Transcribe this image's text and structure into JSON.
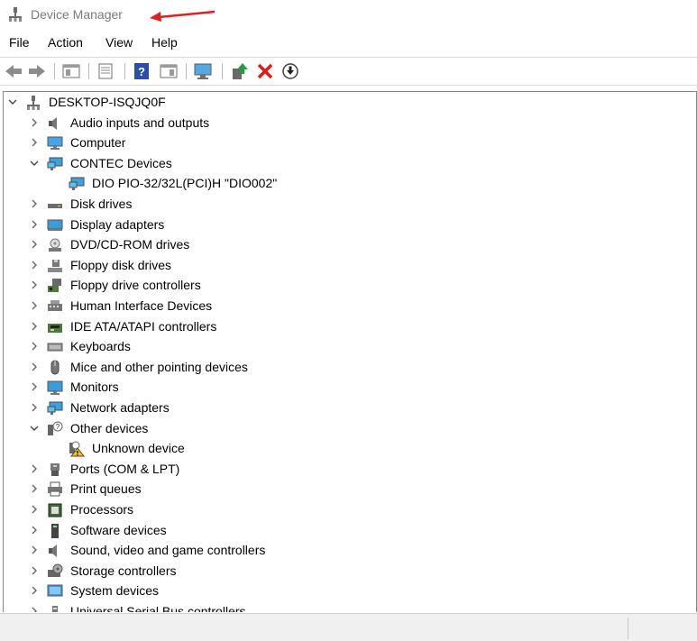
{
  "window": {
    "title": "Device Manager"
  },
  "menu": [
    {
      "label": "File"
    },
    {
      "label": "Action"
    },
    {
      "label": "View"
    },
    {
      "label": "Help"
    }
  ],
  "toolbar": [
    {
      "name": "back-button",
      "icon": "arrow-left-icon"
    },
    {
      "name": "forward-button",
      "icon": "arrow-right-icon"
    },
    {
      "name": "show-hide-console-tree-button",
      "icon": "console-tree-icon"
    },
    {
      "name": "properties-button",
      "icon": "properties-icon"
    },
    {
      "name": "help-button",
      "icon": "help-icon"
    },
    {
      "name": "action-pane-button",
      "icon": "action-pane-icon"
    },
    {
      "name": "scan-hardware-button",
      "icon": "monitor-scan-icon"
    },
    {
      "name": "update-driver-button",
      "icon": "update-driver-icon"
    },
    {
      "name": "uninstall-device-button",
      "icon": "red-x-icon"
    },
    {
      "name": "disable-device-button",
      "icon": "down-arrow-circle-icon"
    }
  ],
  "tree": {
    "root": "DESKTOP-ISQJQ0F",
    "items": [
      {
        "label": "Audio inputs and outputs",
        "icon": "speaker-icon",
        "state": "collapsed",
        "level": 1
      },
      {
        "label": "Computer",
        "icon": "computer-icon",
        "state": "collapsed",
        "level": 1
      },
      {
        "label": "CONTEC Devices",
        "icon": "network-monitor-icon",
        "state": "expanded",
        "level": 1
      },
      {
        "label": "DIO PIO-32/32L(PCI)H \"DIO002\"",
        "icon": "network-monitor-icon",
        "state": "leaf",
        "level": 2
      },
      {
        "label": "Disk drives",
        "icon": "disk-drive-icon",
        "state": "collapsed",
        "level": 1
      },
      {
        "label": "Display adapters",
        "icon": "display-adapter-icon",
        "state": "collapsed",
        "level": 1
      },
      {
        "label": "DVD/CD-ROM drives",
        "icon": "dvd-drive-icon",
        "state": "collapsed",
        "level": 1
      },
      {
        "label": "Floppy disk drives",
        "icon": "floppy-drive-icon",
        "state": "collapsed",
        "level": 1
      },
      {
        "label": "Floppy drive controllers",
        "icon": "floppy-controller-icon",
        "state": "collapsed",
        "level": 1
      },
      {
        "label": "Human Interface Devices",
        "icon": "hid-icon",
        "state": "collapsed",
        "level": 1
      },
      {
        "label": "IDE ATA/ATAPI controllers",
        "icon": "ide-controller-icon",
        "state": "collapsed",
        "level": 1
      },
      {
        "label": "Keyboards",
        "icon": "keyboard-icon",
        "state": "collapsed",
        "level": 1
      },
      {
        "label": "Mice and other pointing devices",
        "icon": "mouse-icon",
        "state": "collapsed",
        "level": 1
      },
      {
        "label": "Monitors",
        "icon": "monitor-icon",
        "state": "collapsed",
        "level": 1
      },
      {
        "label": "Network adapters",
        "icon": "network-adapter-icon",
        "state": "collapsed",
        "level": 1
      },
      {
        "label": "Other devices",
        "icon": "other-devices-icon",
        "state": "expanded",
        "level": 1
      },
      {
        "label": "Unknown device",
        "icon": "unknown-device-warning-icon",
        "state": "leaf",
        "level": 2
      },
      {
        "label": "Ports (COM & LPT)",
        "icon": "port-icon",
        "state": "collapsed",
        "level": 1
      },
      {
        "label": "Print queues",
        "icon": "printer-icon",
        "state": "collapsed",
        "level": 1
      },
      {
        "label": "Processors",
        "icon": "processor-icon",
        "state": "collapsed",
        "level": 1
      },
      {
        "label": "Software devices",
        "icon": "software-device-icon",
        "state": "collapsed",
        "level": 1
      },
      {
        "label": "Sound, video and game controllers",
        "icon": "speaker-icon",
        "state": "collapsed",
        "level": 1
      },
      {
        "label": "Storage controllers",
        "icon": "storage-controller-icon",
        "state": "collapsed",
        "level": 1
      },
      {
        "label": "System devices",
        "icon": "system-device-icon",
        "state": "collapsed",
        "level": 1
      },
      {
        "label": "Universal Serial Bus controllers",
        "icon": "usb-icon",
        "state": "collapsed",
        "level": 1
      }
    ]
  },
  "colors": {
    "annotation_arrow": "#e02020",
    "tree_border": "#828790",
    "status_bg": "#f0f0f0"
  }
}
